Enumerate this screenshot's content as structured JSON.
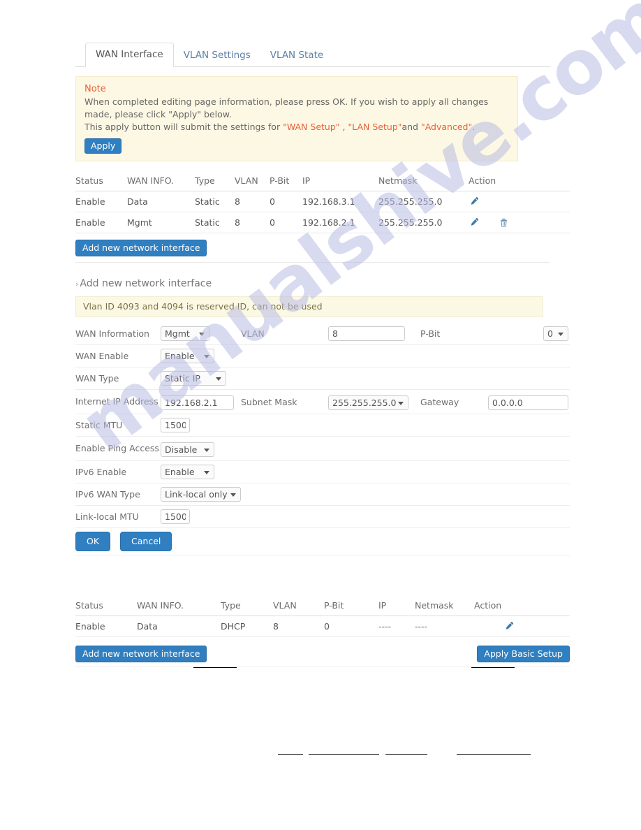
{
  "tabs": [
    {
      "label": "WAN Interface",
      "active": true
    },
    {
      "label": "VLAN Settings",
      "active": false
    },
    {
      "label": "VLAN State",
      "active": false
    }
  ],
  "note": {
    "title": "Note",
    "line1": "When completed editing page information, please press OK. If you wish to apply all changes made, please click",
    "line2": "\"Apply\" below.",
    "line3_pre": "This apply button will submit the settings for ",
    "link_wan": "\"WAN Setup\"",
    "sep1": " , ",
    "link_lan": "\"LAN Setup\"",
    "sep2": "and ",
    "link_adv": "\"Advanced\"",
    "sep3": ".",
    "apply_label": "Apply"
  },
  "top_table": {
    "headers": [
      "Status",
      "WAN INFO.",
      "Type",
      "VLAN",
      "P-Bit",
      "IP",
      "Netmask",
      "Action"
    ],
    "rows": [
      {
        "status": "Enable",
        "wan_info": "Data",
        "type": "Static",
        "vlan": "8",
        "pbit": "0",
        "ip": "192.168.3.1",
        "netmask": "255.255.255.0",
        "actions": [
          "edit-icon"
        ]
      },
      {
        "status": "Enable",
        "wan_info": "Mgmt",
        "type": "Static",
        "vlan": "8",
        "pbit": "0",
        "ip": "192.168.2.1",
        "netmask": "255.255.255.0",
        "actions": [
          "edit-icon",
          "delete-icon"
        ]
      }
    ],
    "add_button": "Add new network interface"
  },
  "section": {
    "chevron": "›",
    "title": "Add new network interface",
    "info": "Vlan ID 4093 and 4094 is reserved ID, can not be used"
  },
  "form": {
    "wan_information_label": "WAN Information",
    "wan_information_value": "Mgmt",
    "vlan_label": "VLAN",
    "vlan_value": "8",
    "pbit_label": "P-Bit",
    "pbit_value": "0",
    "wan_enable_label": "WAN Enable",
    "wan_enable_value": "Enable",
    "wan_type_label": "WAN Type",
    "wan_type_value": "Static IP",
    "internet_ip_label": "Internet IP Address",
    "internet_ip_value": "192.168.2.1",
    "subnet_mask_label": "Subnet Mask",
    "subnet_mask_value": "255.255.255.0",
    "gateway_label": "Gateway",
    "gateway_value": "0.0.0.0",
    "static_mtu_label": "Static MTU",
    "static_mtu_value": "1500",
    "enable_ping_label": "Enable Ping Access",
    "enable_ping_value": "Disable",
    "ipv6_enable_label": "IPv6 Enable",
    "ipv6_enable_value": "Enable",
    "ipv6_wan_type_label": "IPv6 WAN Type",
    "ipv6_wan_type_value": "Link-local only",
    "linklocal_mtu_label": "Link-local MTU",
    "linklocal_mtu_value": "1500",
    "ok_label": "OK",
    "cancel_label": "Cancel"
  },
  "bottom_table": {
    "headers": [
      "Status",
      "WAN INFO.",
      "Type",
      "VLAN",
      "P-Bit",
      "IP",
      "Netmask",
      "Action"
    ],
    "rows": [
      {
        "status": "Enable",
        "wan_info": "Data",
        "type": "DHCP",
        "vlan": "8",
        "pbit": "0",
        "ip": "----",
        "netmask": "----",
        "actions": [
          "edit-icon"
        ]
      }
    ],
    "add_button": "Add new network interface",
    "apply_button": "Apply Basic Setup"
  },
  "watermark": {
    "text": "manualshive.com"
  },
  "colors": {
    "accent": "#2f7fc1",
    "note_red": "#e8603c",
    "note_bg": "#fdf8e3",
    "tab_link": "#5b7fa6",
    "icon_blue": "#3d7ca9"
  }
}
